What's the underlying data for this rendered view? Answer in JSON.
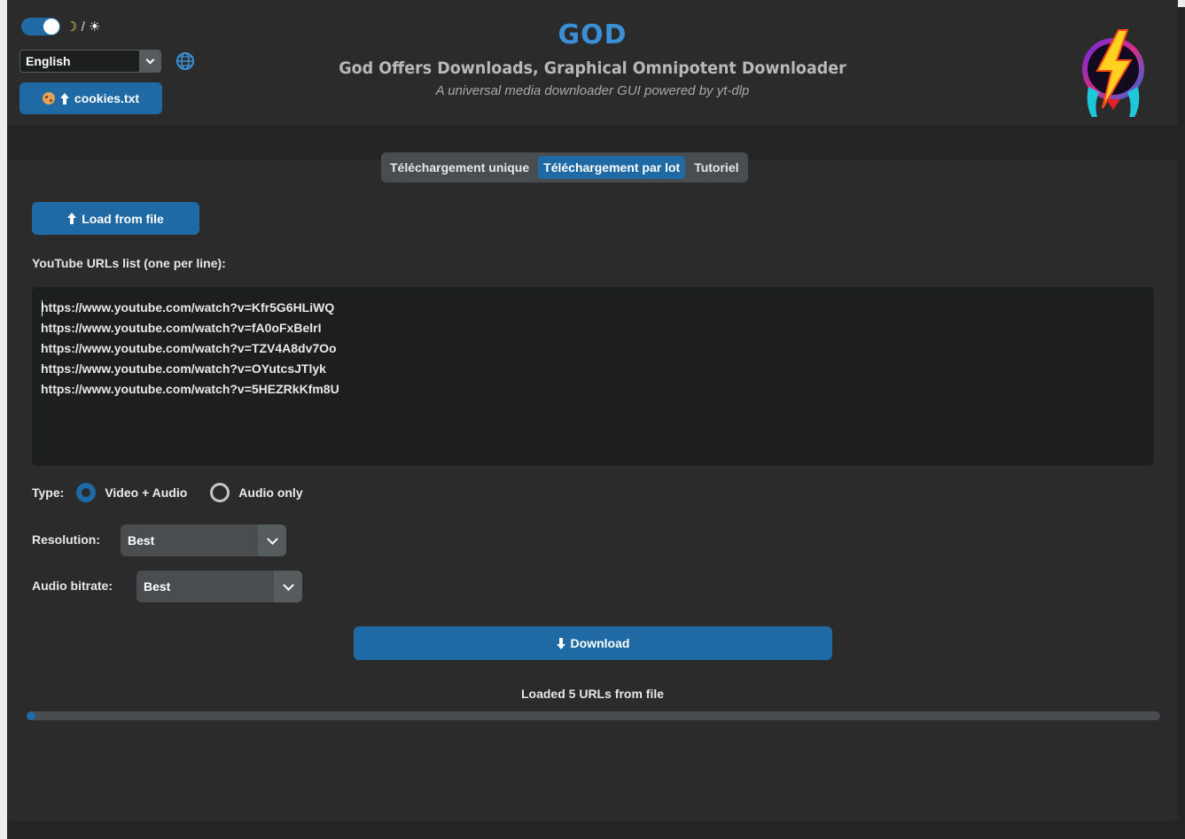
{
  "header": {
    "theme_toggle": {
      "on": true,
      "label_moon": "☽",
      "label_sep": "/",
      "label_sun": "☀"
    },
    "language": {
      "selected": "English"
    },
    "cookies_button": "cookies.txt",
    "title": "GOD",
    "subtitle": "God Offers Downloads, Graphical Omnipotent Downloader",
    "tagline": "A universal media downloader GUI powered by yt-dlp"
  },
  "tabs": [
    {
      "label": "Téléchargement unique",
      "active": false
    },
    {
      "label": "Téléchargement par lot",
      "active": true
    },
    {
      "label": "Tutoriel",
      "active": false
    }
  ],
  "batch": {
    "load_button": "Load from file",
    "url_list_label": "YouTube URLs list (one per line):",
    "urls": [
      "https://www.youtube.com/watch?v=Kfr5G6HLiWQ",
      "https://www.youtube.com/watch?v=fA0oFxBelrI",
      "https://www.youtube.com/watch?v=TZV4A8dv7Oo",
      "https://www.youtube.com/watch?v=OYutcsJTlyk",
      "https://www.youtube.com/watch?v=5HEZRkKfm8U"
    ],
    "type_label": "Type:",
    "type_options": [
      "Video + Audio",
      "Audio only"
    ],
    "type_selected": "Video + Audio",
    "resolution_label": "Resolution:",
    "resolution_value": "Best",
    "bitrate_label": "Audio bitrate:",
    "bitrate_value": "Best",
    "download_button": "Download",
    "status_text": "Loaded 5 URLs from file",
    "progress": 0.005
  },
  "colors": {
    "accent": "#1f6aa5",
    "title": "#3a8fd6",
    "background": "#242424"
  }
}
